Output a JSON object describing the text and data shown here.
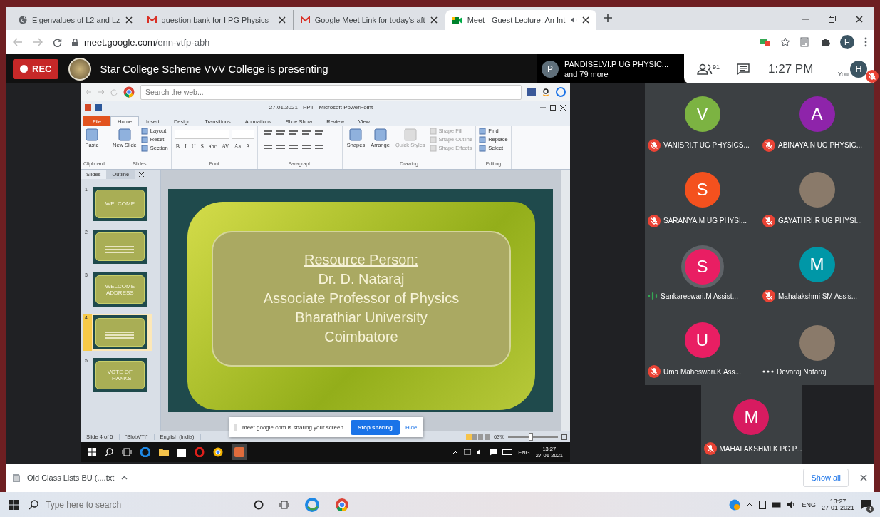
{
  "browser": {
    "tabs": [
      {
        "title": "Eigenvalues of L2 and Lz",
        "kind": "web",
        "selected": false,
        "audio": false
      },
      {
        "title": "question bank for I PG Physics - ",
        "kind": "mail",
        "selected": false,
        "audio": false
      },
      {
        "title": "Google Meet Link for today's aft",
        "kind": "mail",
        "selected": false,
        "audio": false
      },
      {
        "title": "Meet - Guest Lecture: An Int",
        "kind": "meet",
        "selected": true,
        "audio": true
      }
    ],
    "url_host": "meet.google.com",
    "url_path": "/enn-vtfp-abh",
    "profile_initial": "H"
  },
  "meet": {
    "rec_label": "REC",
    "presenting_text": "Star College Scheme VVV College is presenting",
    "presenter": {
      "initial": "P",
      "name": "PANDISELVI.P UG PHYSIC...",
      "more": "and 79 more"
    },
    "people_count": "91",
    "time": "1:27 PM",
    "self": {
      "initial": "H",
      "label": "You",
      "muted": true
    }
  },
  "shared_screen": {
    "search_placeholder": "Search the web...",
    "ppt_title": "27.01.2021 - PPT  -  Microsoft PowerPoint",
    "ribbon_tabs": [
      {
        "label": "File",
        "kind": "file",
        "selected": false
      },
      {
        "label": "Home",
        "kind": "tab",
        "selected": true
      },
      {
        "label": "Insert",
        "kind": "tab",
        "selected": false
      },
      {
        "label": "Design",
        "kind": "tab",
        "selected": false
      },
      {
        "label": "Transitions",
        "kind": "tab",
        "selected": false
      },
      {
        "label": "Animations",
        "kind": "tab",
        "selected": false
      },
      {
        "label": "Slide Show",
        "kind": "tab",
        "selected": false
      },
      {
        "label": "Review",
        "kind": "tab",
        "selected": false
      },
      {
        "label": "View",
        "kind": "tab",
        "selected": false
      }
    ],
    "ribbon_groups": [
      {
        "label": "Clipboard",
        "kind": "buttons",
        "buttons": [
          {
            "label": "Paste",
            "kind": "large"
          }
        ]
      },
      {
        "label": "Slides",
        "kind": "buttons",
        "buttons": [
          {
            "label": "New Slide",
            "kind": "large"
          },
          {
            "label": "Layout",
            "kind": "small"
          },
          {
            "label": "Reset",
            "kind": "small"
          },
          {
            "label": "Section",
            "kind": "small"
          }
        ]
      },
      {
        "label": "Font",
        "kind": "font",
        "buttons": [
          {
            "label": "B"
          },
          {
            "label": "I"
          },
          {
            "label": "U"
          },
          {
            "label": "S"
          },
          {
            "label": "abc"
          },
          {
            "label": "AV"
          },
          {
            "label": "Aa"
          },
          {
            "label": "A"
          }
        ]
      },
      {
        "label": "Paragraph",
        "kind": "paragraph"
      },
      {
        "label": "Drawing",
        "kind": "buttons",
        "buttons": [
          {
            "label": "Shapes",
            "kind": "large",
            "disabled": false
          },
          {
            "label": "Arrange",
            "kind": "large",
            "disabled": false
          },
          {
            "label": "Quick Styles",
            "kind": "large",
            "disabled": true
          },
          {
            "label": "Shape Fill",
            "kind": "small",
            "disabled": true
          },
          {
            "label": "Shape Outline",
            "kind": "small",
            "disabled": true
          },
          {
            "label": "Shape Effects",
            "kind": "small",
            "disabled": true
          }
        ]
      },
      {
        "label": "Editing",
        "kind": "buttons",
        "buttons": [
          {
            "label": "Find",
            "kind": "small"
          },
          {
            "label": "Replace",
            "kind": "small"
          },
          {
            "label": "Select",
            "kind": "small"
          }
        ]
      }
    ],
    "pane_tabs": [
      {
        "label": "Slides",
        "selected": true
      },
      {
        "label": "Outline",
        "selected": false
      }
    ],
    "thumbnails": [
      {
        "number": "1",
        "title": "WELCOME",
        "selected": false
      },
      {
        "number": "2",
        "selected": false
      },
      {
        "number": "3",
        "title": "WELCOME ADDRESS",
        "selected": false
      },
      {
        "number": "4",
        "selected": true
      },
      {
        "number": "5",
        "title": "VOTE OF THANKS",
        "selected": false
      }
    ],
    "slide_lines": [
      {
        "text": "Resource Person:",
        "underlined": true
      },
      {
        "text": "Dr. D. Nataraj",
        "underlined": false
      },
      {
        "text": "Associate Professor of Physics",
        "underlined": false
      },
      {
        "text": "Bharathiar University",
        "underlined": false
      },
      {
        "text": "Coimbatore",
        "underlined": false
      }
    ],
    "status": [
      "Slide 4 of 5",
      "\"BlobVTI\"",
      "English (India)"
    ],
    "zoom": "63%",
    "zoom_slider": {
      "level": 0.45
    },
    "share_bar": {
      "message": "meet.google.com is sharing your screen.",
      "stop": "Stop sharing",
      "hide": "Hide"
    },
    "taskbar": {
      "lang": "ENG",
      "time": "13:27",
      "date": "27-01-2021"
    }
  },
  "participants": [
    {
      "name": "VANISRI.T UG PHYSICS...",
      "kind": "letter",
      "initial": "V",
      "color": "#7cb342",
      "muted": true,
      "speaking": false
    },
    {
      "name": "ABINAYA.N UG PHYSIC...",
      "kind": "letter",
      "initial": "A",
      "color": "#8e24aa",
      "muted": true,
      "speaking": false
    },
    {
      "name": "SARANYA.M UG PHYSI...",
      "kind": "letter",
      "initial": "S",
      "color": "#f4511e",
      "muted": true,
      "speaking": false
    },
    {
      "name": "GAYATHRI.R UG PHYSI...",
      "kind": "photo",
      "muted": true,
      "speaking": false
    },
    {
      "name": "Sankareswari.M Assist...",
      "kind": "letter",
      "initial": "S",
      "color": "#e91e63",
      "muted": false,
      "speaking": true
    },
    {
      "name": "Mahalakshmi SM Assis...",
      "kind": "letter",
      "initial": "M",
      "color": "#0097a7",
      "muted": true,
      "speaking": false
    },
    {
      "name": "Uma Maheswari.K Ass...",
      "kind": "letter",
      "initial": "U",
      "color": "#e91e63",
      "muted": true,
      "speaking": false
    },
    {
      "name": "Devaraj Nataraj",
      "kind": "photo",
      "muted": false,
      "speaking": false
    }
  ],
  "bottom_participant": {
    "name": "MAHALAKSHMI.K PG P...",
    "kind": "letter",
    "initial": "M",
    "color": "#d81b60",
    "muted": true,
    "speaking": false
  },
  "downloads": {
    "file": "Old Class Lists BU (....txt",
    "show_all": "Show all"
  },
  "taskbar": {
    "search_placeholder": "Type here to search",
    "lang": "ENG",
    "time": "13:27",
    "date": "27-01-2021",
    "notifications": "4"
  }
}
